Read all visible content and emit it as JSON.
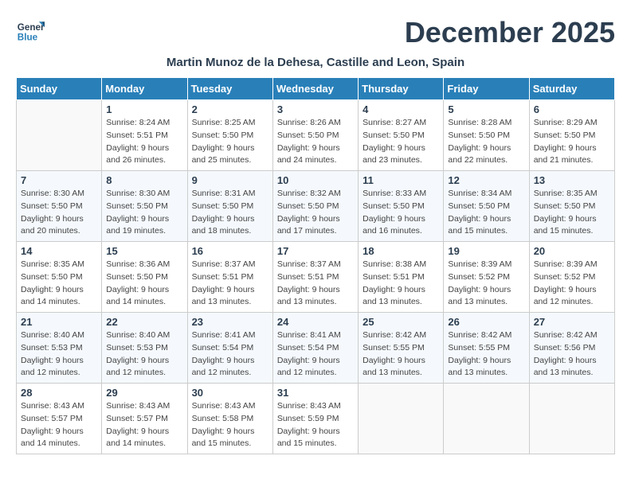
{
  "header": {
    "logo_general": "General",
    "logo_blue": "Blue",
    "month_title": "December 2025",
    "location": "Martin Munoz de la Dehesa, Castille and Leon, Spain"
  },
  "weekdays": [
    "Sunday",
    "Monday",
    "Tuesday",
    "Wednesday",
    "Thursday",
    "Friday",
    "Saturday"
  ],
  "weeks": [
    [
      {
        "day": "",
        "sunrise": "",
        "sunset": "",
        "daylight": ""
      },
      {
        "day": "1",
        "sunrise": "Sunrise: 8:24 AM",
        "sunset": "Sunset: 5:51 PM",
        "daylight": "Daylight: 9 hours and 26 minutes."
      },
      {
        "day": "2",
        "sunrise": "Sunrise: 8:25 AM",
        "sunset": "Sunset: 5:50 PM",
        "daylight": "Daylight: 9 hours and 25 minutes."
      },
      {
        "day": "3",
        "sunrise": "Sunrise: 8:26 AM",
        "sunset": "Sunset: 5:50 PM",
        "daylight": "Daylight: 9 hours and 24 minutes."
      },
      {
        "day": "4",
        "sunrise": "Sunrise: 8:27 AM",
        "sunset": "Sunset: 5:50 PM",
        "daylight": "Daylight: 9 hours and 23 minutes."
      },
      {
        "day": "5",
        "sunrise": "Sunrise: 8:28 AM",
        "sunset": "Sunset: 5:50 PM",
        "daylight": "Daylight: 9 hours and 22 minutes."
      },
      {
        "day": "6",
        "sunrise": "Sunrise: 8:29 AM",
        "sunset": "Sunset: 5:50 PM",
        "daylight": "Daylight: 9 hours and 21 minutes."
      }
    ],
    [
      {
        "day": "7",
        "sunrise": "Sunrise: 8:30 AM",
        "sunset": "Sunset: 5:50 PM",
        "daylight": "Daylight: 9 hours and 20 minutes."
      },
      {
        "day": "8",
        "sunrise": "Sunrise: 8:30 AM",
        "sunset": "Sunset: 5:50 PM",
        "daylight": "Daylight: 9 hours and 19 minutes."
      },
      {
        "day": "9",
        "sunrise": "Sunrise: 8:31 AM",
        "sunset": "Sunset: 5:50 PM",
        "daylight": "Daylight: 9 hours and 18 minutes."
      },
      {
        "day": "10",
        "sunrise": "Sunrise: 8:32 AM",
        "sunset": "Sunset: 5:50 PM",
        "daylight": "Daylight: 9 hours and 17 minutes."
      },
      {
        "day": "11",
        "sunrise": "Sunrise: 8:33 AM",
        "sunset": "Sunset: 5:50 PM",
        "daylight": "Daylight: 9 hours and 16 minutes."
      },
      {
        "day": "12",
        "sunrise": "Sunrise: 8:34 AM",
        "sunset": "Sunset: 5:50 PM",
        "daylight": "Daylight: 9 hours and 15 minutes."
      },
      {
        "day": "13",
        "sunrise": "Sunrise: 8:35 AM",
        "sunset": "Sunset: 5:50 PM",
        "daylight": "Daylight: 9 hours and 15 minutes."
      }
    ],
    [
      {
        "day": "14",
        "sunrise": "Sunrise: 8:35 AM",
        "sunset": "Sunset: 5:50 PM",
        "daylight": "Daylight: 9 hours and 14 minutes."
      },
      {
        "day": "15",
        "sunrise": "Sunrise: 8:36 AM",
        "sunset": "Sunset: 5:50 PM",
        "daylight": "Daylight: 9 hours and 14 minutes."
      },
      {
        "day": "16",
        "sunrise": "Sunrise: 8:37 AM",
        "sunset": "Sunset: 5:51 PM",
        "daylight": "Daylight: 9 hours and 13 minutes."
      },
      {
        "day": "17",
        "sunrise": "Sunrise: 8:37 AM",
        "sunset": "Sunset: 5:51 PM",
        "daylight": "Daylight: 9 hours and 13 minutes."
      },
      {
        "day": "18",
        "sunrise": "Sunrise: 8:38 AM",
        "sunset": "Sunset: 5:51 PM",
        "daylight": "Daylight: 9 hours and 13 minutes."
      },
      {
        "day": "19",
        "sunrise": "Sunrise: 8:39 AM",
        "sunset": "Sunset: 5:52 PM",
        "daylight": "Daylight: 9 hours and 13 minutes."
      },
      {
        "day": "20",
        "sunrise": "Sunrise: 8:39 AM",
        "sunset": "Sunset: 5:52 PM",
        "daylight": "Daylight: 9 hours and 12 minutes."
      }
    ],
    [
      {
        "day": "21",
        "sunrise": "Sunrise: 8:40 AM",
        "sunset": "Sunset: 5:53 PM",
        "daylight": "Daylight: 9 hours and 12 minutes."
      },
      {
        "day": "22",
        "sunrise": "Sunrise: 8:40 AM",
        "sunset": "Sunset: 5:53 PM",
        "daylight": "Daylight: 9 hours and 12 minutes."
      },
      {
        "day": "23",
        "sunrise": "Sunrise: 8:41 AM",
        "sunset": "Sunset: 5:54 PM",
        "daylight": "Daylight: 9 hours and 12 minutes."
      },
      {
        "day": "24",
        "sunrise": "Sunrise: 8:41 AM",
        "sunset": "Sunset: 5:54 PM",
        "daylight": "Daylight: 9 hours and 12 minutes."
      },
      {
        "day": "25",
        "sunrise": "Sunrise: 8:42 AM",
        "sunset": "Sunset: 5:55 PM",
        "daylight": "Daylight: 9 hours and 13 minutes."
      },
      {
        "day": "26",
        "sunrise": "Sunrise: 8:42 AM",
        "sunset": "Sunset: 5:55 PM",
        "daylight": "Daylight: 9 hours and 13 minutes."
      },
      {
        "day": "27",
        "sunrise": "Sunrise: 8:42 AM",
        "sunset": "Sunset: 5:56 PM",
        "daylight": "Daylight: 9 hours and 13 minutes."
      }
    ],
    [
      {
        "day": "28",
        "sunrise": "Sunrise: 8:43 AM",
        "sunset": "Sunset: 5:57 PM",
        "daylight": "Daylight: 9 hours and 14 minutes."
      },
      {
        "day": "29",
        "sunrise": "Sunrise: 8:43 AM",
        "sunset": "Sunset: 5:57 PM",
        "daylight": "Daylight: 9 hours and 14 minutes."
      },
      {
        "day": "30",
        "sunrise": "Sunrise: 8:43 AM",
        "sunset": "Sunset: 5:58 PM",
        "daylight": "Daylight: 9 hours and 15 minutes."
      },
      {
        "day": "31",
        "sunrise": "Sunrise: 8:43 AM",
        "sunset": "Sunset: 5:59 PM",
        "daylight": "Daylight: 9 hours and 15 minutes."
      },
      {
        "day": "",
        "sunrise": "",
        "sunset": "",
        "daylight": ""
      },
      {
        "day": "",
        "sunrise": "",
        "sunset": "",
        "daylight": ""
      },
      {
        "day": "",
        "sunrise": "",
        "sunset": "",
        "daylight": ""
      }
    ]
  ]
}
